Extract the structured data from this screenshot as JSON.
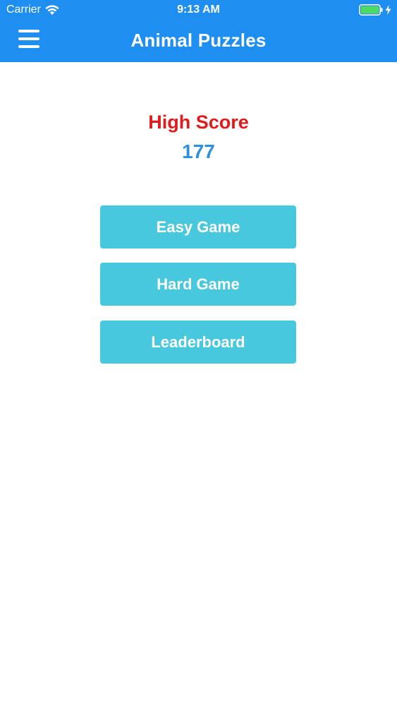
{
  "status_bar": {
    "carrier": "Carrier",
    "time": "9:13 AM",
    "icons": [
      "wifi-icon",
      "battery-icon",
      "charging-bolt-icon"
    ],
    "battery_color": "#4cd964"
  },
  "nav": {
    "title": "Animal Puzzles",
    "menu_icon": "hamburger-menu-icon",
    "background_color": "#1e8ff0"
  },
  "high_score": {
    "label": "High Score",
    "value": "177",
    "label_color": "#e01b1b",
    "value_color": "#2e90dd"
  },
  "menu": {
    "button_color": "#48c8dc",
    "easy_label": "Easy Game",
    "hard_label": "Hard Game",
    "leaderboard_label": "Leaderboard"
  }
}
